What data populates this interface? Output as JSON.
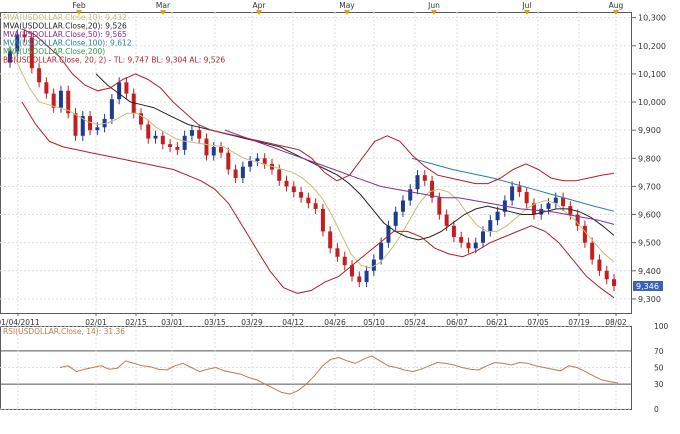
{
  "chart_data": [
    {
      "type": "candlestick",
      "title": "",
      "months": [
        "Feb",
        "Mar",
        "Apr",
        "May",
        "Jun",
        "Jul",
        "Aug"
      ],
      "x_tick_labels": [
        "01/04/2011",
        "02/01",
        "02/15",
        "03/01",
        "03/15",
        "03/29",
        "04/12",
        "04/26",
        "05/10",
        "05/24",
        "06/07",
        "06/21",
        "07/05",
        "07/19",
        "08/02"
      ],
      "y_tick_labels": [
        "9,300",
        "9,400",
        "9,500",
        "9,600",
        "9,700",
        "9,800",
        "9,900",
        "10,000",
        "10,100",
        "10,200",
        "10,300"
      ],
      "ylim": [
        9250,
        10320
      ],
      "last_price_label": "9,346",
      "legend": [
        {
          "text": "MVA(USDOLLAR.Close,10): 9,432",
          "color": "#c8bf74"
        },
        {
          "text": "MVA(USDOLLAR.Close,20): 9,526",
          "color": "#222222"
        },
        {
          "text": "MVA(USDOLLAR.Close,50): 9,565",
          "color": "#7b2fa4"
        },
        {
          "text": "MVA(USDOLLAR.Close,100): 9,612",
          "color": "#2a7f9a"
        },
        {
          "text": "MVA(USDOLLAR.Close,200)",
          "color": "#3c9c4a"
        },
        {
          "text": "BB(USDOLLAR.Close, 20, 2) -  TL: 9,747  BL: 9,304  AL: 9,526",
          "color": "#b21f2b"
        }
      ],
      "closes": [
        10180,
        10240,
        10230,
        10120,
        10070,
        10030,
        9980,
        10040,
        9960,
        9880,
        9950,
        9900,
        9910,
        9940,
        10010,
        10070,
        10030,
        9960,
        9920,
        9870,
        9880,
        9850,
        9840,
        9830,
        9880,
        9900,
        9870,
        9810,
        9840,
        9820,
        9760,
        9730,
        9770,
        9790,
        9800,
        9780,
        9760,
        9720,
        9700,
        9680,
        9660,
        9640,
        9620,
        9540,
        9480,
        9450,
        9420,
        9380,
        9360,
        9400,
        9440,
        9500,
        9560,
        9610,
        9650,
        9690,
        9740,
        9720,
        9660,
        9600,
        9560,
        9520,
        9500,
        9480,
        9500,
        9540,
        9580,
        9610,
        9650,
        9700,
        9680,
        9640,
        9600,
        9620,
        9640,
        9660,
        9630,
        9600,
        9560,
        9500,
        9440,
        9400,
        9370,
        9346
      ],
      "series": [
        {
          "name": "MVA(USDOLLAR.Close,10)",
          "color": "#c8bf74",
          "values": [
            10200,
            10120,
            10050,
            10000,
            9990,
            9980,
            9970,
            9950,
            9930,
            9920,
            9925,
            9940,
            9960,
            9960,
            9940,
            9910,
            9890,
            9870,
            9860,
            9855,
            9850,
            9845,
            9840,
            9820,
            9800,
            9790,
            9780,
            9770,
            9760,
            9750,
            9730,
            9700,
            9660,
            9600,
            9530,
            9460,
            9420,
            9410,
            9430,
            9470,
            9520,
            9580,
            9640,
            9680,
            9690,
            9680,
            9650,
            9600,
            9560,
            9540,
            9540,
            9560,
            9590,
            9620,
            9640,
            9650,
            9640,
            9610,
            9580,
            9540,
            9500,
            9460,
            9432
          ]
        },
        {
          "name": "MVA(USDOLLAR.Close,20)",
          "color": "#222222",
          "values": [
            10100,
            10060,
            10030,
            10000,
            9990,
            9980,
            9960,
            9940,
            9920,
            9910,
            9900,
            9890,
            9880,
            9870,
            9860,
            9850,
            9840,
            9820,
            9800,
            9780,
            9760,
            9740,
            9710,
            9670,
            9620,
            9570,
            9540,
            9520,
            9510,
            9520,
            9540,
            9570,
            9600,
            9620,
            9630,
            9620,
            9610,
            9600,
            9600,
            9610,
            9620,
            9620,
            9610,
            9590,
            9560,
            9526
          ]
        },
        {
          "name": "MVA(USDOLLAR.Close,50)",
          "color": "#7b2fa4",
          "values": [
            9900,
            9880,
            9860,
            9840,
            9820,
            9800,
            9780,
            9760,
            9740,
            9720,
            9700,
            9690,
            9680,
            9670,
            9660,
            9660,
            9650,
            9640,
            9630,
            9620,
            9615,
            9610,
            9600,
            9590,
            9580,
            9565
          ]
        },
        {
          "name": "MVA(USDOLLAR.Close,100)",
          "color": "#2a7f9a",
          "values": [
            9800,
            9780,
            9760,
            9745,
            9730,
            9710,
            9690,
            9670,
            9650,
            9630,
            9612
          ]
        },
        {
          "name": "BB upper",
          "color": "#b21f2b",
          "values": [
            10260,
            10240,
            10200,
            10160,
            10100,
            10060,
            10040,
            10050,
            10080,
            10100,
            10080,
            10050,
            10000,
            9960,
            9920,
            9900,
            9890,
            9880,
            9870,
            9860,
            9850,
            9840,
            9830,
            9800,
            9750,
            9720,
            9740,
            9800,
            9860,
            9880,
            9860,
            9810,
            9770,
            9740,
            9730,
            9720,
            9710,
            9710,
            9730,
            9760,
            9780,
            9760,
            9730,
            9720,
            9720,
            9730,
            9740,
            9747
          ]
        },
        {
          "name": "BB lower",
          "color": "#b21f2b",
          "values": [
            10000,
            9920,
            9860,
            9840,
            9830,
            9820,
            9810,
            9800,
            9790,
            9780,
            9770,
            9760,
            9740,
            9720,
            9690,
            9640,
            9560,
            9480,
            9400,
            9340,
            9320,
            9330,
            9360,
            9380,
            9420,
            9460,
            9500,
            9540,
            9540,
            9520,
            9480,
            9460,
            9450,
            9470,
            9500,
            9520,
            9540,
            9560,
            9540,
            9500,
            9440,
            9380,
            9340,
            9304
          ]
        }
      ]
    },
    {
      "type": "line",
      "title": "RSI(USDOLLAR.Close, 14): 31.36",
      "y_tick_labels": [
        "100",
        "70",
        "50",
        "30",
        "0"
      ],
      "ylim": [
        0,
        100
      ],
      "levels": [
        70,
        30
      ],
      "series": [
        {
          "name": "RSI(USDOLLAR.Close, 14)",
          "color": "#c07a4a",
          "values": [
            50,
            52,
            45,
            48,
            50,
            52,
            48,
            49,
            58,
            55,
            52,
            51,
            48,
            47,
            52,
            55,
            50,
            45,
            48,
            50,
            46,
            44,
            42,
            38,
            35,
            30,
            25,
            20,
            18,
            22,
            30,
            40,
            52,
            60,
            62,
            58,
            55,
            60,
            64,
            58,
            52,
            50,
            47,
            45,
            48,
            52,
            56,
            55,
            53,
            50,
            48,
            47,
            52,
            56,
            55,
            53,
            56,
            55,
            52,
            50,
            48,
            46,
            52,
            50,
            45,
            40,
            35,
            33,
            31.36
          ]
        }
      ]
    }
  ]
}
